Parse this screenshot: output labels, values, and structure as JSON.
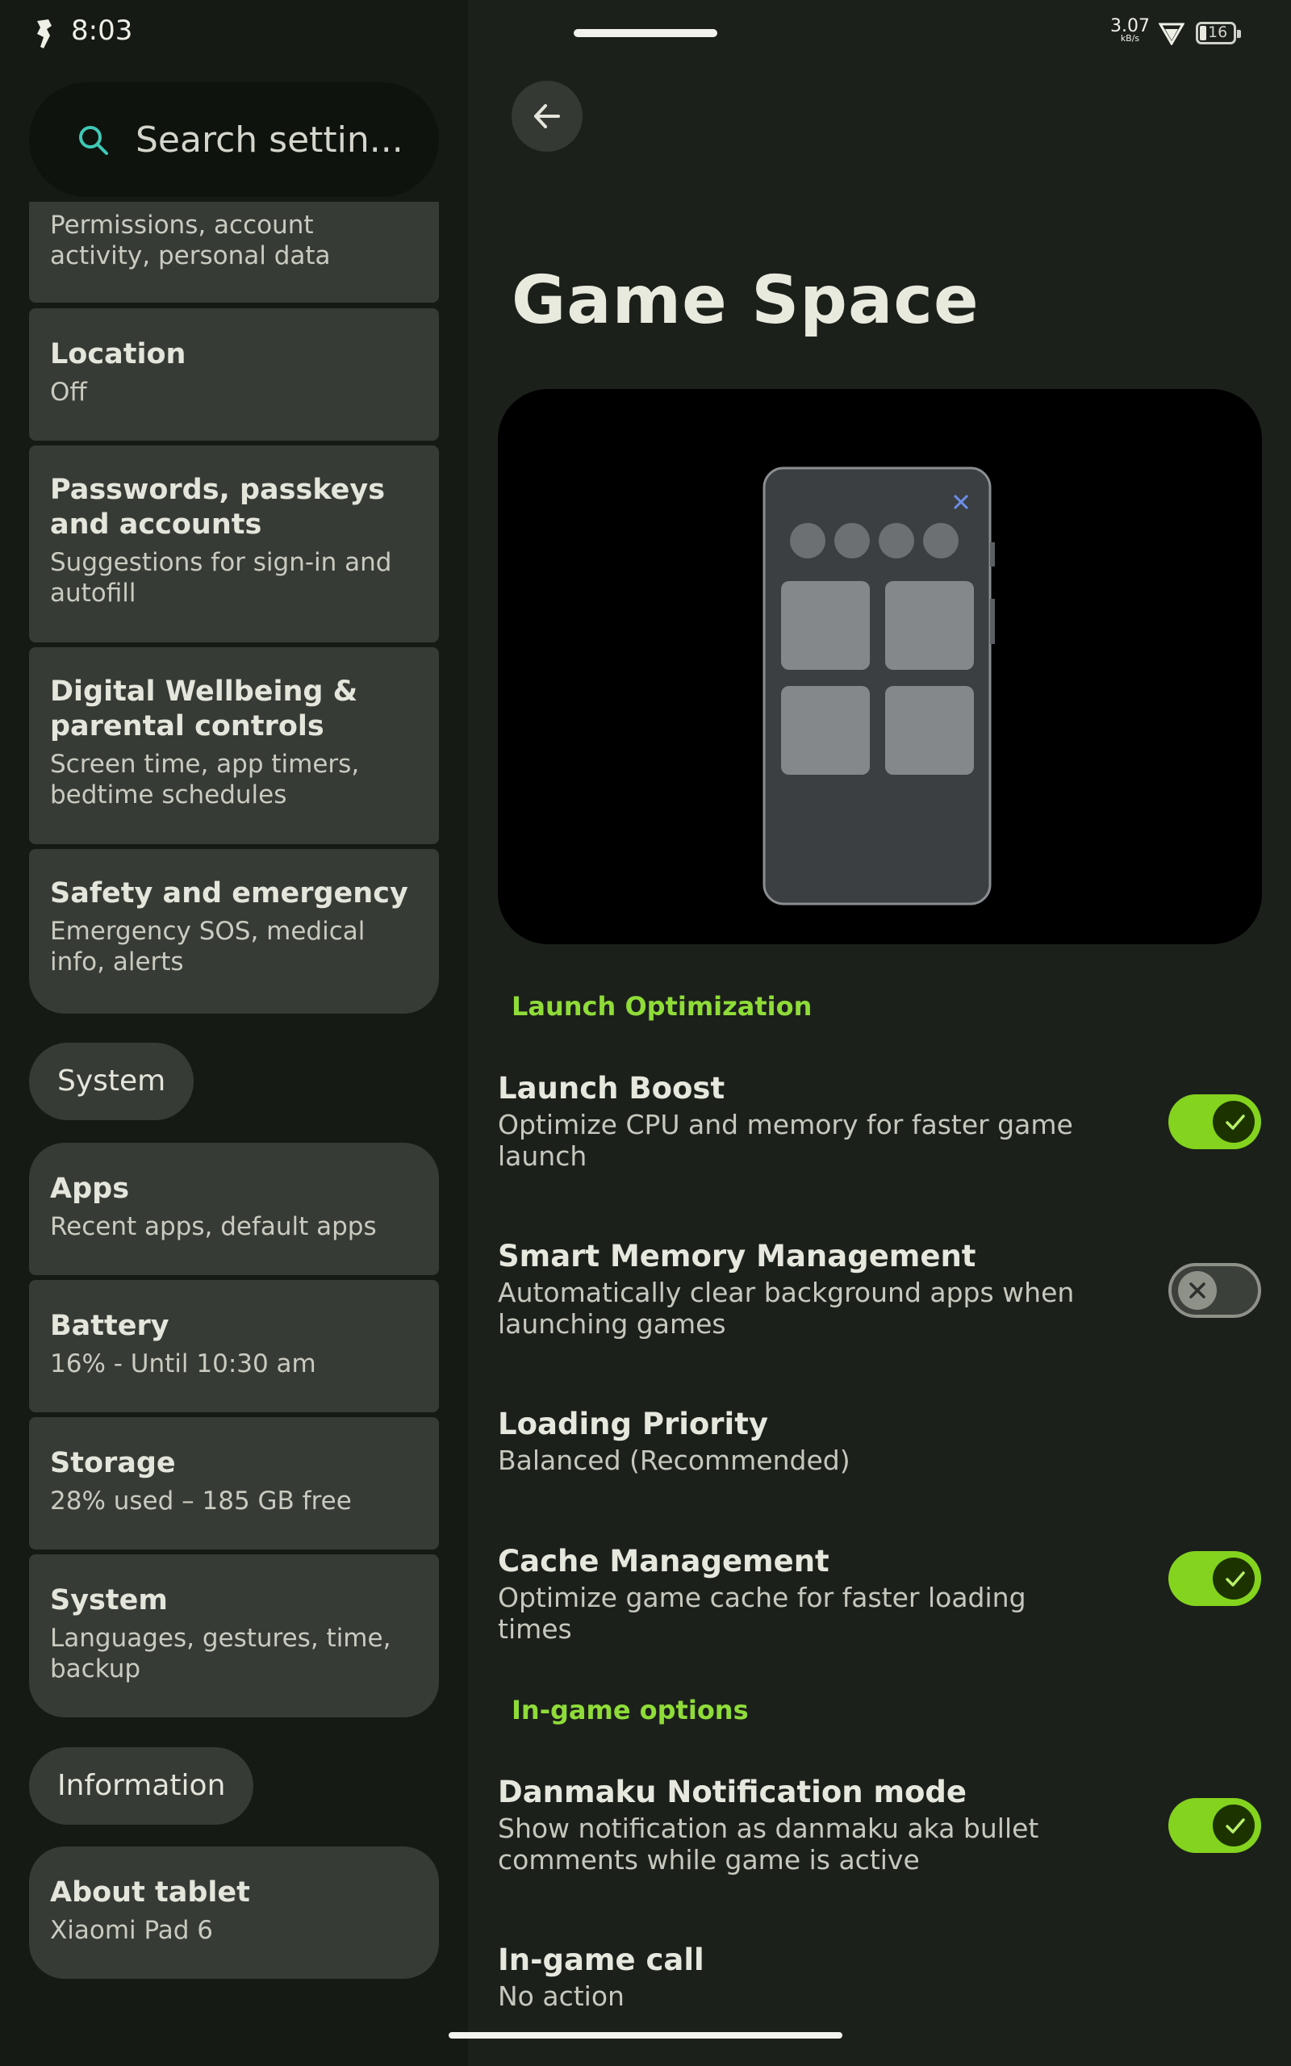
{
  "status": {
    "time": "8:03",
    "speed_value": "3.07",
    "speed_unit": "kB/s",
    "battery": "16"
  },
  "search": {
    "placeholder": "Search settin..."
  },
  "sidebar": {
    "partial_item": {
      "subtitle": "Permissions, account activity, personal data"
    },
    "items_a": [
      {
        "title": "Location",
        "subtitle": "Off"
      },
      {
        "title": "Passwords, passkeys and accounts",
        "subtitle": "Suggestions for sign-in and autofill"
      },
      {
        "title": "Digital Wellbeing & parental controls",
        "subtitle": "Screen time, app timers, bedtime schedules"
      },
      {
        "title": "Safety and emergency",
        "subtitle": "Emergency SOS, medical info, alerts"
      }
    ],
    "header_system": "System",
    "items_b": [
      {
        "title": "Apps",
        "subtitle": "Recent apps, default apps"
      },
      {
        "title": "Battery",
        "subtitle": "16% - Until 10:30 am"
      },
      {
        "title": "Storage",
        "subtitle": "28% used – 185 GB free"
      },
      {
        "title": "System",
        "subtitle": "Languages, gestures, time, backup"
      }
    ],
    "header_information": "Information",
    "items_c": [
      {
        "title": "About tablet",
        "subtitle": "Xiaomi Pad 6"
      }
    ]
  },
  "page": {
    "title": "Game Space"
  },
  "sections": {
    "launch": "Launch Optimization",
    "ingame": "In-game options"
  },
  "settings": [
    {
      "title": "Launch Boost",
      "subtitle": "Optimize CPU and memory for faster game launch",
      "toggle": "on"
    },
    {
      "title": "Smart Memory Management",
      "subtitle": "Automatically clear background apps when launching games",
      "toggle": "off"
    },
    {
      "title": "Loading Priority",
      "subtitle": "Balanced (Recommended)"
    },
    {
      "title": "Cache Management",
      "subtitle": "Optimize game cache for faster loading times",
      "toggle": "on"
    },
    {
      "title": "Danmaku Notification mode",
      "subtitle": "Show notification as danmaku aka bullet comments while game is active",
      "toggle": "on"
    },
    {
      "title": "In-game call",
      "subtitle": "No action"
    }
  ],
  "colors": {
    "accent": "#84d31e",
    "section_header": "#8fdc38",
    "card": "#373b35",
    "background": "#1c201b",
    "sidebar": "#161a15"
  }
}
